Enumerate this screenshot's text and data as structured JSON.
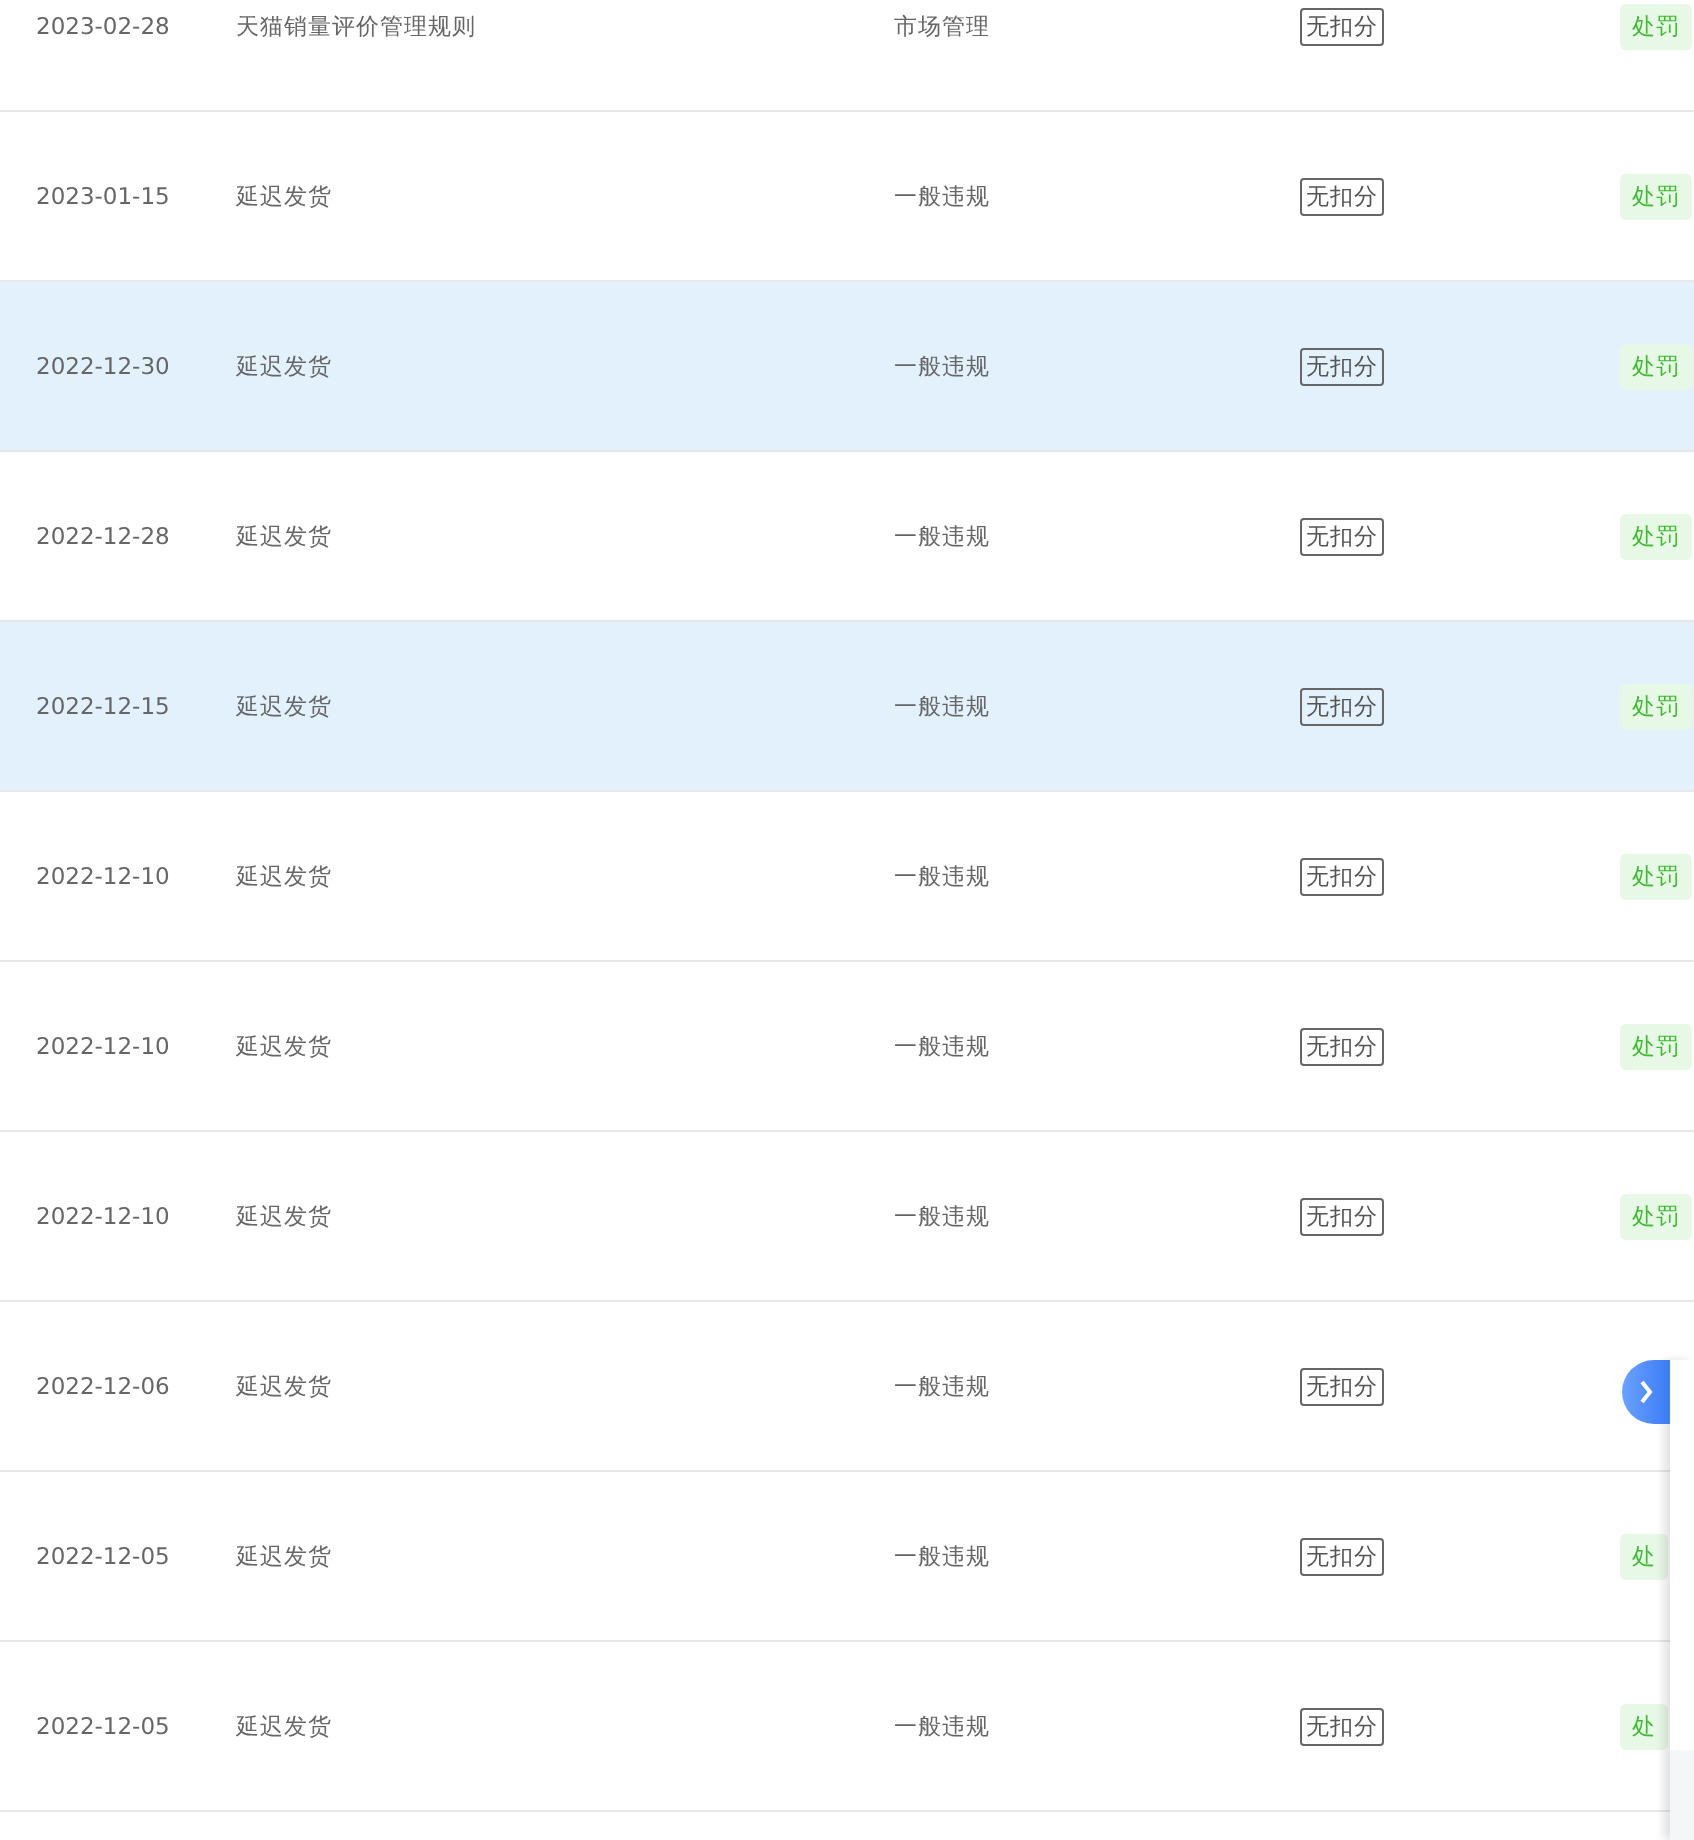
{
  "rows": [
    {
      "date": "2023-02-28",
      "rule": "天猫销量评价管理规则",
      "category": "市场管理",
      "score": "无扣分",
      "status": "处罚",
      "highlighted": false
    },
    {
      "date": "2023-01-15",
      "rule": "延迟发货",
      "category": "一般违规",
      "score": "无扣分",
      "status": "处罚",
      "highlighted": false
    },
    {
      "date": "2022-12-30",
      "rule": "延迟发货",
      "category": "一般违规",
      "score": "无扣分",
      "status": "处罚",
      "highlighted": true
    },
    {
      "date": "2022-12-28",
      "rule": "延迟发货",
      "category": "一般违规",
      "score": "无扣分",
      "status": "处罚",
      "highlighted": false
    },
    {
      "date": "2022-12-15",
      "rule": "延迟发货",
      "category": "一般违规",
      "score": "无扣分",
      "status": "处罚",
      "highlighted": true
    },
    {
      "date": "2022-12-10",
      "rule": "延迟发货",
      "category": "一般违规",
      "score": "无扣分",
      "status": "处罚",
      "highlighted": false
    },
    {
      "date": "2022-12-10",
      "rule": "延迟发货",
      "category": "一般违规",
      "score": "无扣分",
      "status": "处罚",
      "highlighted": false
    },
    {
      "date": "2022-12-10",
      "rule": "延迟发货",
      "category": "一般违规",
      "score": "无扣分",
      "status": "处罚",
      "highlighted": false
    },
    {
      "date": "2022-12-06",
      "rule": "延迟发货",
      "category": "一般违规",
      "score": "无扣分",
      "highlighted": false
    },
    {
      "date": "2022-12-05",
      "rule": "延迟发货",
      "category": "一般违规",
      "score": "无扣分",
      "status": "处",
      "highlighted": false
    },
    {
      "date": "2022-12-05",
      "rule": "延迟发货",
      "category": "一般违规",
      "score": "无扣分",
      "status": "处",
      "highlighted": false
    }
  ],
  "side_panel": {
    "expanded": false
  }
}
